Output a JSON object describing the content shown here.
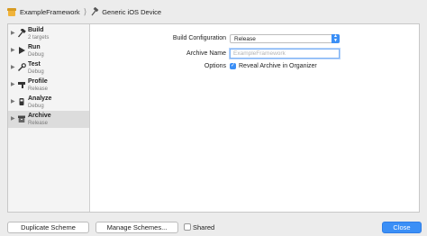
{
  "breadcrumb": {
    "scheme": {
      "label": "ExampleFramework",
      "icon": "toolbox-icon"
    },
    "separator": "⟩",
    "destination": {
      "label": "Generic iOS Device",
      "icon": "hammer-icon"
    }
  },
  "sidebar": {
    "items": [
      {
        "title": "Build",
        "subtitle": "2 targets",
        "icon": "hammer-icon",
        "selected": false
      },
      {
        "title": "Run",
        "subtitle": "Debug",
        "icon": "play-icon",
        "selected": false
      },
      {
        "title": "Test",
        "subtitle": "Debug",
        "icon": "wrench-icon",
        "selected": false
      },
      {
        "title": "Profile",
        "subtitle": "Release",
        "icon": "gauge-icon",
        "selected": false
      },
      {
        "title": "Analyze",
        "subtitle": "Debug",
        "icon": "analyze-icon",
        "selected": false
      },
      {
        "title": "Archive",
        "subtitle": "Release",
        "icon": "archive-icon",
        "selected": true
      }
    ]
  },
  "archive": {
    "build_configuration_label": "Build Configuration",
    "build_configuration_value": "Release",
    "archive_name_label": "Archive Name",
    "archive_name_placeholder": "ExampleFramework",
    "archive_name_value": "",
    "options_label": "Options",
    "reveal_label": "Reveal Archive in Organizer",
    "reveal_checked": true
  },
  "footer": {
    "duplicate_label": "Duplicate Scheme",
    "manage_label": "Manage Schemes...",
    "shared_label": "Shared",
    "shared_checked": false,
    "close_label": "Close"
  },
  "colors": {
    "accent": "#3b8ff6",
    "selection": "#dcdcdc",
    "sidebar_bg": "#f4f4f4"
  }
}
